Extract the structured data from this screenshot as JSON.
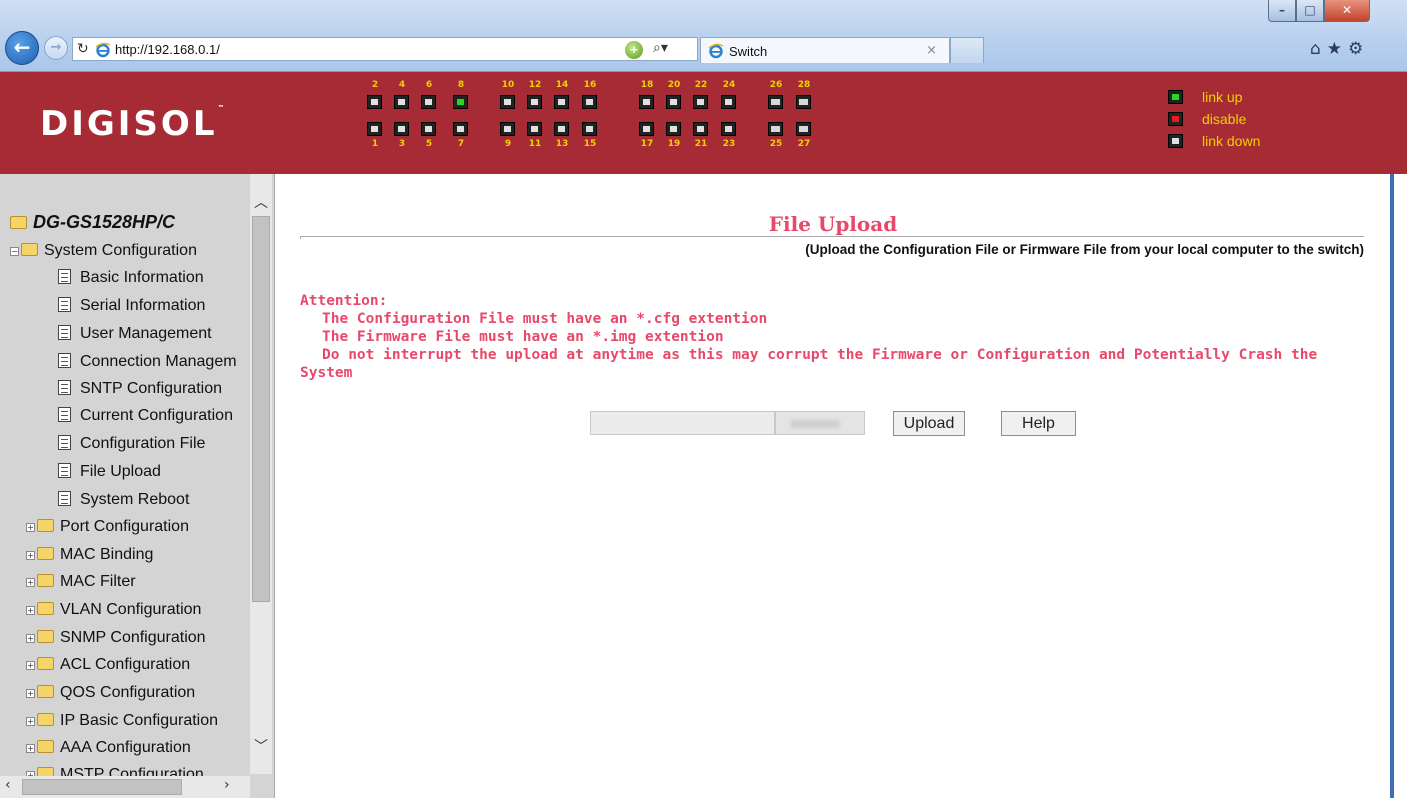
{
  "browser": {
    "url": "http://192.168.0.1/",
    "tab_title": "Switch",
    "tab_close": "×",
    "toolbar_icons": "⌂★⚙"
  },
  "header": {
    "logo": "DIGISOL",
    "logo_tm": "™",
    "top_port_numbers": [
      "2",
      "4",
      "6",
      "8",
      "10",
      "12",
      "14",
      "16",
      "18",
      "20",
      "22",
      "24",
      "26",
      "28"
    ],
    "bottom_port_numbers": [
      "1",
      "3",
      "5",
      "7",
      "9",
      "11",
      "13",
      "15",
      "17",
      "19",
      "21",
      "23",
      "25",
      "27"
    ],
    "port_states": {
      "8": "link up"
    },
    "legend": [
      "link up",
      "disable",
      "link down"
    ],
    "colors": {
      "banner": "#a62b35",
      "port_label": "#f2d000",
      "link_up": "#2ad52a",
      "disable": "#e02020",
      "link_down": "#e0e0e0"
    }
  },
  "sidebar": {
    "root": "DG-GS1528HP/C",
    "open_folder": "System Configuration",
    "children": [
      "Basic Information",
      "Serial Information",
      "User Management",
      "Connection Managem",
      "SNTP Configuration",
      "Current Configuration",
      "Configuration File",
      "File Upload",
      "System Reboot"
    ],
    "folders": [
      "Port Configuration",
      "MAC Binding",
      "MAC Filter",
      "VLAN Configuration",
      "SNMP Configuration",
      "ACL Configuration",
      "QOS Configuration",
      "IP Basic Configuration",
      "AAA Configuration",
      "MSTP Configuration"
    ]
  },
  "main": {
    "title": "File Upload",
    "subtitle": "(Upload the Configuration File or Firmware File from your local computer to the switch)",
    "attention_label": "Attention:",
    "attention_lines": [
      "The Configuration File must have an *.cfg extention",
      "The Firmware File must have an *.img extention",
      "Do not interrupt the upload at anytime as this may corrupt the Firmware or Configuration and Potentially Crash the"
    ],
    "attention_tail": "System",
    "upload_button": "Upload",
    "help_button": "Help",
    "accent_color": "#e8496a"
  }
}
